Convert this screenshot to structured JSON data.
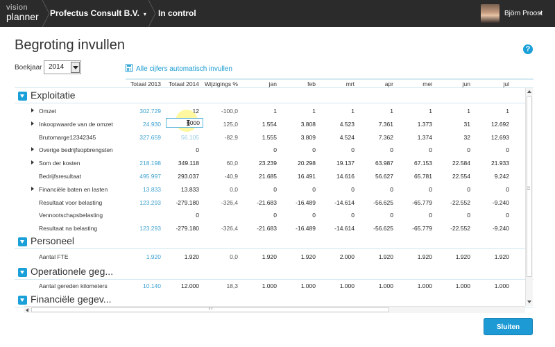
{
  "topbar": {
    "logo_line1": "vision",
    "logo_line2": "planner",
    "company": "Profectus Consult B.V.",
    "company_caret": "▾",
    "module": "In control",
    "user": "Björn Proost",
    "user_caret": "▾"
  },
  "page": {
    "title": "Begroting invullen",
    "help": "?"
  },
  "year": {
    "label": "Boekjaar",
    "value": "2014"
  },
  "auto_fill_link": "Alle cijfers automatisch invullen",
  "columns": [
    "Totaal 2013",
    "Totaal 2014",
    "Wijzigings %",
    "jan",
    "feb",
    "mrt",
    "apr",
    "mei",
    "jun",
    "jul"
  ],
  "sections": [
    {
      "title": "Exploitatie",
      "rows": [
        {
          "label": "Omzet",
          "expandable": true,
          "values": [
            "302.729",
            "12",
            "-100,0",
            "1",
            "1",
            "1",
            "1",
            "1",
            "1",
            "1"
          ]
        },
        {
          "label": "Inkoopwaarde van de omzet",
          "expandable": true,
          "values": [
            "24.930",
            "6000",
            "125,0",
            "1.554",
            "3.808",
            "4.523",
            "7.361",
            "1.373",
            "31",
            "12.692"
          ]
        },
        {
          "label": "Brutomarge12342345",
          "expandable": false,
          "values": [
            "327.659",
            "56.105",
            "-82,9",
            "1.555",
            "3.809",
            "4.524",
            "7.362",
            "1.374",
            "32",
            "12.693"
          ]
        },
        {
          "label": "Overige bedrijfsopbrengsten",
          "expandable": true,
          "values": [
            "",
            "0",
            "",
            "0",
            "0",
            "0",
            "0",
            "0",
            "0",
            "0"
          ]
        },
        {
          "label": "Som der kosten",
          "expandable": true,
          "values": [
            "218.198",
            "349.118",
            "60,0",
            "23.239",
            "20.298",
            "19.137",
            "63.987",
            "67.153",
            "22.584",
            "21.933"
          ]
        },
        {
          "label": "Bedrijfsresultaat",
          "expandable": false,
          "values": [
            "495.997",
            "293.037",
            "-40,9",
            "21.685",
            "16.491",
            "14.616",
            "56.627",
            "65.781",
            "22.554",
            "9.242"
          ]
        },
        {
          "label": "Financiële baten en lasten",
          "expandable": true,
          "values": [
            "13.833",
            "13.833",
            "0,0",
            "0",
            "0",
            "0",
            "0",
            "0",
            "0",
            "0"
          ]
        },
        {
          "label": "Resultaat voor belasting",
          "expandable": false,
          "values": [
            "123.293",
            "-279.180",
            "-326,4",
            "-21.683",
            "-16.489",
            "-14.614",
            "-56.625",
            "-65.779",
            "-22.552",
            "-9.240"
          ]
        },
        {
          "label": "Vennootschapsbelasting",
          "expandable": false,
          "values": [
            "",
            "0",
            "",
            "0",
            "0",
            "0",
            "0",
            "0",
            "0",
            "0"
          ]
        },
        {
          "label": "Resultaat na belasting",
          "expandable": false,
          "values": [
            "123.293",
            "-279.180",
            "-326,4",
            "-21.683",
            "-16.489",
            "-14.614",
            "-56.625",
            "-65.779",
            "-22.552",
            "-9.240"
          ]
        }
      ]
    },
    {
      "title": "Personeel",
      "rows": [
        {
          "label": "Aantal FTE",
          "expandable": false,
          "values": [
            "1.920",
            "1.920",
            "0,0",
            "1.920",
            "1.920",
            "2.000",
            "1.920",
            "1.920",
            "1.920",
            "1.920"
          ]
        }
      ]
    },
    {
      "title": "Operationele geg...",
      "rows": [
        {
          "label": "Aantal gereden kilometers",
          "expandable": false,
          "values": [
            "10.140",
            "12.000",
            "18,3",
            "1.000",
            "1.000",
            "1.000",
            "1.000",
            "1.000",
            "1.000",
            "1.000"
          ]
        }
      ]
    },
    {
      "title": "Financiële gegev...",
      "rows": []
    }
  ],
  "close_button": "Sluiten",
  "colors": {
    "topbar": "#2b2b2b",
    "accent": "#1aa0d8",
    "link": "#3aa0cf",
    "button": "#1d9ad4"
  }
}
